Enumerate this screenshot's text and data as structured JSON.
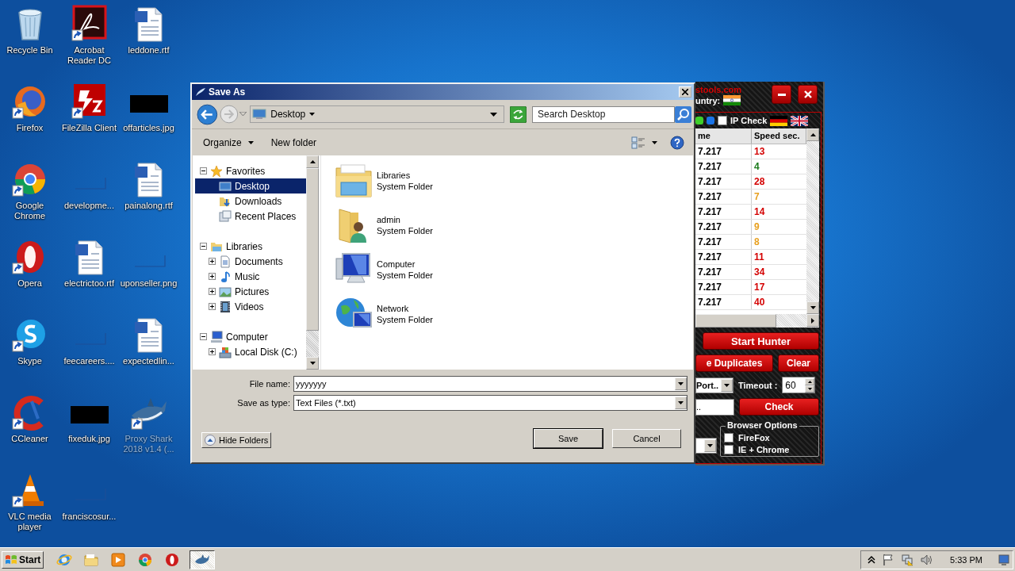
{
  "desktop_icons": [
    {
      "label": "Recycle Bin",
      "kind": "recycle",
      "shortcut": false,
      "dimmed": false
    },
    {
      "label": "Firefox",
      "kind": "firefox",
      "shortcut": true,
      "dimmed": false
    },
    {
      "label": "Google Chrome",
      "kind": "chrome",
      "shortcut": true,
      "dimmed": false
    },
    {
      "label": "Opera",
      "kind": "opera",
      "shortcut": true,
      "dimmed": false
    },
    {
      "label": "Skype",
      "kind": "skype",
      "shortcut": true,
      "dimmed": false
    },
    {
      "label": "CCleaner",
      "kind": "ccleaner",
      "shortcut": true,
      "dimmed": false
    },
    {
      "label": "VLC media player",
      "kind": "vlc",
      "shortcut": true,
      "dimmed": false
    },
    {
      "label": "Acrobat Reader DC",
      "kind": "acrobat",
      "shortcut": true,
      "dimmed": false
    },
    {
      "label": "FileZilla Client",
      "kind": "filezilla",
      "shortcut": true,
      "dimmed": false
    },
    {
      "label": "developme...",
      "kind": "blank",
      "shortcut": false,
      "dimmed": false
    },
    {
      "label": "electrictoo.rtf",
      "kind": "word",
      "shortcut": false,
      "dimmed": false
    },
    {
      "label": "feecareers....",
      "kind": "blank",
      "shortcut": false,
      "dimmed": false
    },
    {
      "label": "fixeduk.jpg",
      "kind": "thumb",
      "shortcut": false,
      "dimmed": false
    },
    {
      "label": "franciscosur...",
      "kind": "blank",
      "shortcut": false,
      "dimmed": false
    },
    {
      "label": "leddone.rtf",
      "kind": "word",
      "shortcut": false,
      "dimmed": false
    },
    {
      "label": "offarticles.jpg",
      "kind": "thumb",
      "shortcut": false,
      "dimmed": false
    },
    {
      "label": "painalong.rtf",
      "kind": "word",
      "shortcut": false,
      "dimmed": false
    },
    {
      "label": "uponseller.png",
      "kind": "blank",
      "shortcut": false,
      "dimmed": false
    },
    {
      "label": "expectedlin...",
      "kind": "word",
      "shortcut": false,
      "dimmed": false
    },
    {
      "label": "Proxy Shark 2018 v1.4 (...",
      "kind": "shark",
      "shortcut": true,
      "dimmed": true
    }
  ],
  "app_window": {
    "title": "stools.com",
    "country_label": "untry:",
    "ip_check": {
      "label": "IP Check",
      "checked": false
    },
    "table": {
      "columns": [
        "me",
        "Speed sec."
      ],
      "rows": [
        {
          "column_1": "7.217",
          "speed": "13",
          "color": "#d40000"
        },
        {
          "column_1": "7.217",
          "speed": "4",
          "color": "#1a7a1a"
        },
        {
          "column_1": "7.217",
          "speed": "28",
          "color": "#d40000"
        },
        {
          "column_1": "7.217",
          "speed": "7",
          "color": "#e8a020"
        },
        {
          "column_1": "7.217",
          "speed": "14",
          "color": "#d40000"
        },
        {
          "column_1": "7.217",
          "speed": "9",
          "color": "#e8a020"
        },
        {
          "column_1": "7.217",
          "speed": "8",
          "color": "#e8a020"
        },
        {
          "column_1": "7.217",
          "speed": "11",
          "color": "#d40000"
        },
        {
          "column_1": "7.217",
          "speed": "34",
          "color": "#d40000"
        },
        {
          "column_1": "7.217",
          "speed": "17",
          "color": "#d40000"
        },
        {
          "column_1": "7.217",
          "speed": "40",
          "color": "#d40000"
        }
      ]
    },
    "start_button": "Start Hunter",
    "duplicates_button": "e Duplicates",
    "clear_button": "Clear",
    "port_select": "Port..",
    "timeout_label": "Timeout :",
    "timeout_value": "60",
    "proxy_field": "..",
    "check_button": "Check",
    "browser_options": {
      "title": "Browser Options",
      "options": [
        {
          "label": "FireFox",
          "checked": false
        },
        {
          "label": "IE + Chrome",
          "checked": false
        }
      ]
    }
  },
  "dialog": {
    "title": "Save As",
    "address": "Desktop",
    "search_placeholder": "Search Desktop",
    "organize": "Organize",
    "new_folder": "New folder",
    "tree": [
      {
        "label": "Favorites",
        "kind": "star",
        "expanded": true,
        "selected": false,
        "children": [
          {
            "label": "Desktop",
            "kind": "desktop",
            "selected": true
          },
          {
            "label": "Downloads",
            "kind": "downloads",
            "selected": false
          },
          {
            "label": "Recent Places",
            "kind": "recent",
            "selected": false
          }
        ]
      },
      {
        "label": "Libraries",
        "kind": "libraries",
        "expanded": true,
        "selected": false,
        "children": [
          {
            "label": "Documents",
            "kind": "documents",
            "expanded": false,
            "selected": false
          },
          {
            "label": "Music",
            "kind": "music",
            "expanded": false,
            "selected": false
          },
          {
            "label": "Pictures",
            "kind": "pictures",
            "expanded": false,
            "selected": false
          },
          {
            "label": "Videos",
            "kind": "videos",
            "expanded": false,
            "selected": false
          }
        ]
      },
      {
        "label": "Computer",
        "kind": "computer",
        "expanded": true,
        "selected": false,
        "children": [
          {
            "label": "Local Disk (C:)",
            "kind": "disk",
            "expanded": false,
            "selected": false
          }
        ]
      }
    ],
    "items": [
      {
        "name": "Libraries",
        "type": "System Folder",
        "kind": "libraries"
      },
      {
        "name": "admin",
        "type": "System Folder",
        "kind": "user"
      },
      {
        "name": "Computer",
        "type": "System Folder",
        "kind": "computer"
      },
      {
        "name": "Network",
        "type": "System Folder",
        "kind": "network"
      }
    ],
    "file_name_label": "File name:",
    "file_name": "yyyyyyy",
    "type_label": "Save as type:",
    "save_as_type": "Text Files (*.txt)",
    "hide_folders": "Hide Folders",
    "save": "Save",
    "cancel": "Cancel"
  },
  "taskbar": {
    "start": "Start",
    "apps": [
      {
        "kind": "ie",
        "active": false
      },
      {
        "kind": "explorer",
        "active": false
      },
      {
        "kind": "media",
        "active": false
      },
      {
        "kind": "chrome",
        "active": false
      },
      {
        "kind": "opera",
        "active": false
      },
      {
        "kind": "shark",
        "active": true
      }
    ],
    "time": "5:33 PM"
  }
}
